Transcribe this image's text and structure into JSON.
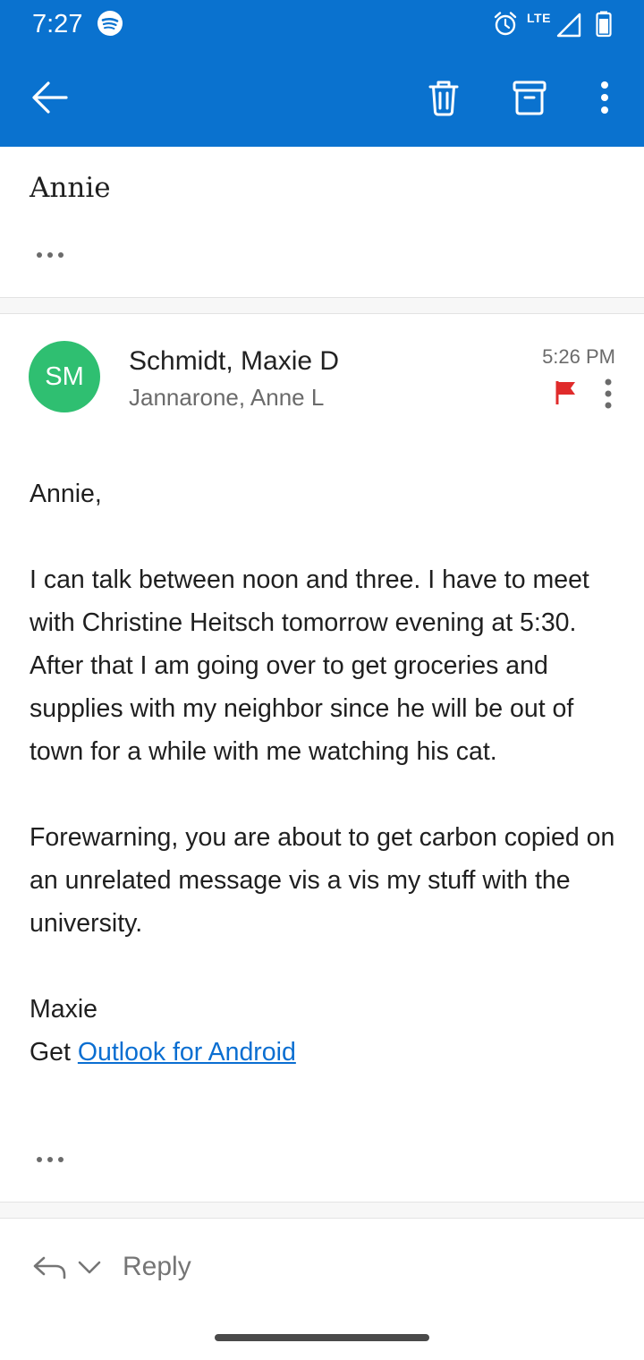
{
  "status_bar": {
    "time": "7:27",
    "network": "LTE",
    "icons": [
      "spotify-icon",
      "alarm-icon",
      "lte-signal-icon",
      "battery-icon"
    ],
    "background": "#0a72cf"
  },
  "toolbar": {
    "icons": [
      "back-arrow-icon",
      "delete-icon",
      "archive-icon",
      "overflow-menu-icon"
    ],
    "background": "#0a72cf"
  },
  "thread": {
    "subject": "Annie"
  },
  "message": {
    "avatar_initials": "SM",
    "avatar_color": "#2fbf71",
    "sender": "Schmidt, Maxie D",
    "recipient": "Jannarone, Anne L",
    "time": "5:26 PM",
    "flag_color": "#e02b2b",
    "greeting": "Annie,",
    "paragraph_1": "I can talk between noon and three. I have to meet with Christine Heitsch tomorrow evening at 5:30. After that I am going over to get groceries and supplies with my neighbor since he will be out of town for a while with me watching his cat.",
    "paragraph_2": "Forewarning, you are about to get carbon copied on an unrelated message vis a vis my stuff with the university.",
    "signature": "Maxie",
    "footer_prefix": "Get ",
    "footer_link": "Outlook for Android"
  },
  "reply_bar": {
    "label": "Reply"
  }
}
